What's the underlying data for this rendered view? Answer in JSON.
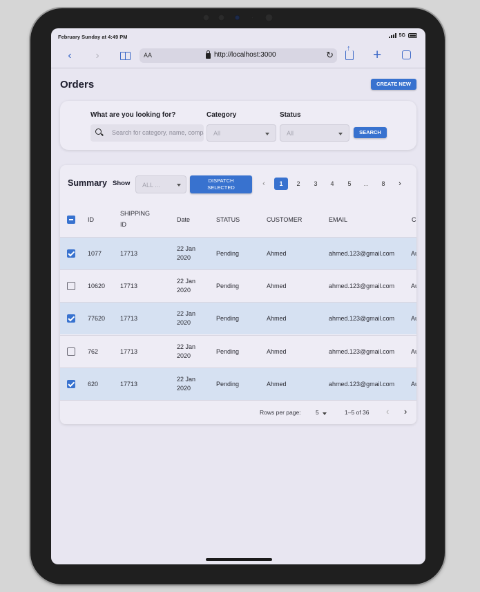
{
  "status_bar": {
    "time": "February Sunday at 4:49 PM",
    "network": "5G"
  },
  "browser": {
    "text_size": "AA",
    "url": "http://localhost:3000"
  },
  "page": {
    "title": "Orders",
    "create_button": "CREATE NEW"
  },
  "filters": {
    "search_label": "What are you looking for?",
    "search_placeholder": "Search for category, name, company, etc",
    "category_label": "Category",
    "category_value": "All",
    "status_label": "Status",
    "status_value": "All",
    "search_button": "SEARCH"
  },
  "summary": {
    "title": "Summary",
    "show_label": "Show",
    "show_value": "ALL ...",
    "dispatch_line1": "DISPATCH",
    "dispatch_line2": "SELECTED",
    "pagination": {
      "prev": "‹",
      "pages": [
        "1",
        "2",
        "3",
        "4",
        "5",
        "...",
        "8"
      ],
      "active": "1",
      "next": "›"
    }
  },
  "table": {
    "columns": {
      "id": "ID",
      "shipping_1": "SHIPPING",
      "shipping_2": "ID",
      "date": "Date",
      "status": "STATUS",
      "customer": "CUSTOMER",
      "email": "EMAIL",
      "more": "C"
    },
    "rows": [
      {
        "checked": true,
        "id": "1077",
        "shipping_id": "17713",
        "date_1": "22 Jan",
        "date_2": "2020",
        "status": "Pending",
        "customer": "Ahmed",
        "email": "ahmed.123@gmail.com",
        "more": "Au"
      },
      {
        "checked": false,
        "id": "10620",
        "shipping_id": "17713",
        "date_1": "22 Jan",
        "date_2": "2020",
        "status": "Pending",
        "customer": "Ahmed",
        "email": "ahmed.123@gmail.com",
        "more": "Au"
      },
      {
        "checked": true,
        "id": "77620",
        "shipping_id": "17713",
        "date_1": "22 Jan",
        "date_2": "2020",
        "status": "Pending",
        "customer": "Ahmed",
        "email": "ahmed.123@gmail.com",
        "more": "Au"
      },
      {
        "checked": false,
        "id": "762",
        "shipping_id": "17713",
        "date_1": "22 Jan",
        "date_2": "2020",
        "status": "Pending",
        "customer": "Ahmed",
        "email": "ahmed.123@gmail.com",
        "more": "Au"
      },
      {
        "checked": true,
        "id": "620",
        "shipping_id": "17713",
        "date_1": "22 Jan",
        "date_2": "2020",
        "status": "Pending",
        "customer": "Ahmed",
        "email": "ahmed.123@gmail.com",
        "more": "Au"
      }
    ],
    "footer": {
      "rows_per_page_label": "Rows per page:",
      "rows_per_page_value": "5",
      "range": "1–5 of 36"
    }
  },
  "colors": {
    "accent": "#3872cf",
    "selected_row": "#d6e1f2",
    "surface": "#eeecf5"
  }
}
